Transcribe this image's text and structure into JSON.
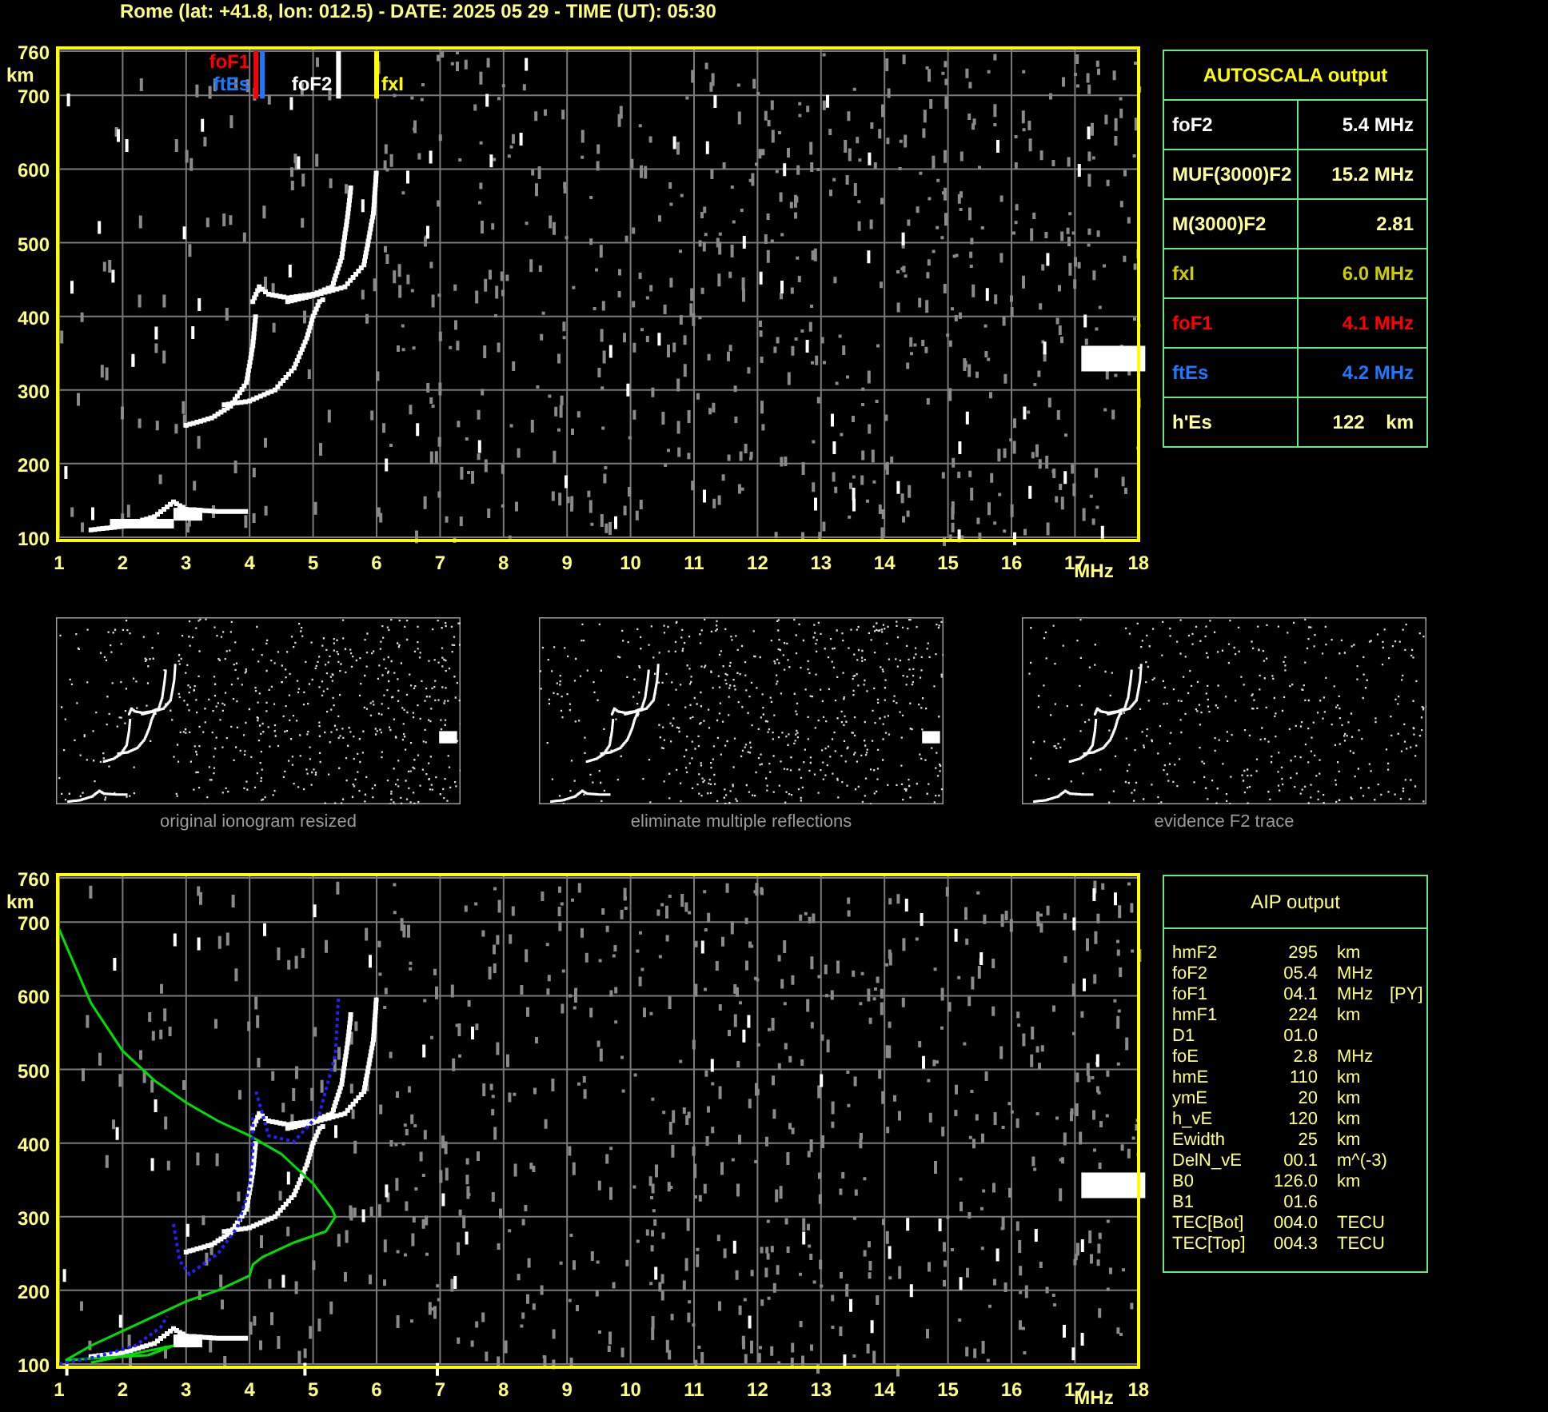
{
  "header": {
    "title": "Rome (lat: +41.8, lon: 012.5) - DATE: 2025 05 29 - TIME (UT): 05:30"
  },
  "top_plot": {
    "y_unit": "km",
    "x_unit": "MHz",
    "y_ticks": [
      "760",
      "700",
      "600",
      "500",
      "400",
      "300",
      "200",
      "100"
    ],
    "x_ticks": [
      "1",
      "2",
      "3",
      "4",
      "5",
      "6",
      "7",
      "8",
      "9",
      "10",
      "11",
      "12",
      "13",
      "14",
      "15",
      "16",
      "17",
      "18"
    ],
    "markers": [
      {
        "label": "foF1",
        "color": "#ff0000"
      },
      {
        "label": "ftEs",
        "color": "#1e78ff"
      },
      {
        "label": "foF2",
        "color": "#ffffff"
      },
      {
        "label": "fxI",
        "color": "#ffff00"
      }
    ]
  },
  "autoscala": {
    "title": "AUTOSCALA output",
    "rows": [
      {
        "name": "foF2",
        "value": "5.4 MHz",
        "color": "#ffffff"
      },
      {
        "name": "MUF(3000)F2",
        "value": "15.2 MHz",
        "color": "#ffff99"
      },
      {
        "name": "M(3000)F2",
        "value": "2.81",
        "color": "#ffff99"
      },
      {
        "name": "fxI",
        "value": "6.0 MHz",
        "color": "#cccc00"
      },
      {
        "name": "foF1",
        "value": "4.1 MHz",
        "color": "#ff0000"
      },
      {
        "name": "ftEs",
        "value": "4.2 MHz",
        "color": "#1e78ff"
      },
      {
        "name": "h'Es",
        "value": "122    km",
        "color": "#ffff99"
      }
    ]
  },
  "thumbnails": [
    {
      "caption": "original ionogram resized"
    },
    {
      "caption": "eliminate multiple reflections"
    },
    {
      "caption": "evidence F2 trace"
    }
  ],
  "bottom_plot": {
    "y_unit": "km",
    "x_unit": "MHz",
    "y_ticks": [
      "760",
      "700",
      "600",
      "500",
      "400",
      "300",
      "200",
      "100"
    ],
    "x_ticks": [
      "1",
      "2",
      "3",
      "4",
      "5",
      "6",
      "7",
      "8",
      "9",
      "10",
      "11",
      "12",
      "13",
      "14",
      "15",
      "16",
      "17",
      "18"
    ]
  },
  "aip": {
    "title": "AIP output",
    "rows": [
      {
        "name": "hmF2",
        "value": "295",
        "unit": "km"
      },
      {
        "name": "foF2",
        "value": "05.4",
        "unit": "MHz"
      },
      {
        "name": "foF1",
        "value": "04.1",
        "unit": "MHz",
        "note": "[PY]"
      },
      {
        "name": "hmF1",
        "value": "224",
        "unit": "km"
      },
      {
        "name": "D1",
        "value": "01.0"
      },
      {
        "name": "foE",
        "value": "2.8",
        "unit": "MHz"
      },
      {
        "name": "hmE",
        "value": "110",
        "unit": "km"
      },
      {
        "name": "ymE",
        "value": "20",
        "unit": "km"
      },
      {
        "name": "h_vE",
        "value": "120",
        "unit": "km"
      },
      {
        "name": "Ewidth",
        "value": "25",
        "unit": "km"
      },
      {
        "name": "DelN_vE",
        "value": "00.1",
        "unit": "m^(-3)"
      },
      {
        "name": "B0",
        "value": "126.0",
        "unit": "km"
      },
      {
        "name": "B1",
        "value": "01.6"
      },
      {
        "name": "TEC[Bot]",
        "value": "004.0",
        "unit": "TECU"
      },
      {
        "name": "TEC[Top]",
        "value": "004.3",
        "unit": "TECU"
      }
    ]
  }
}
